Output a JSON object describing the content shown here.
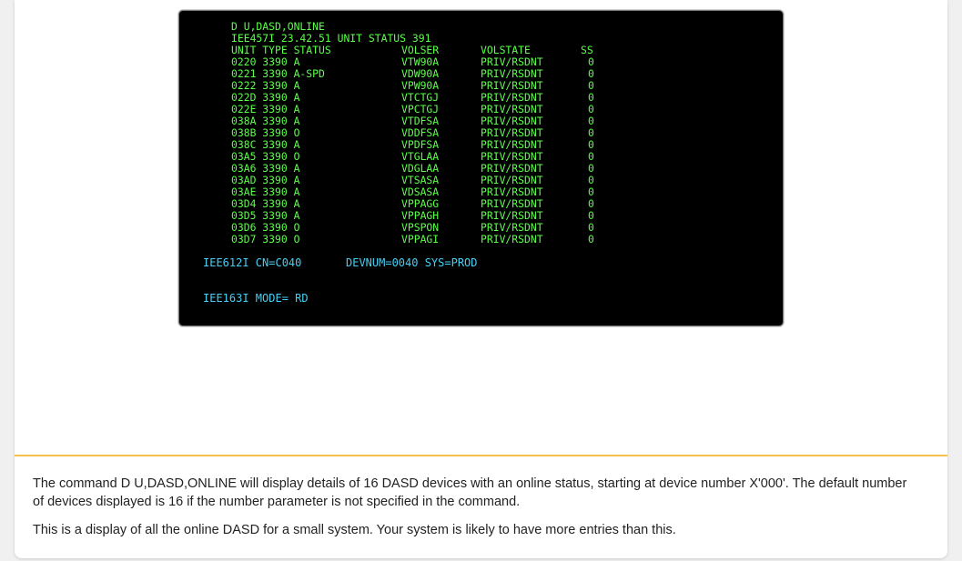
{
  "terminal": {
    "command": "D U,DASD,ONLINE",
    "response_header": "IEE457I 23.42.51 UNIT STATUS 391",
    "columns": {
      "unit_type_status": "UNIT TYPE STATUS",
      "volser": "VOLSER",
      "volstate": "VOLSTATE",
      "ss": "SS"
    },
    "rows": [
      {
        "unit": "0220 3390 A",
        "volser": "VTW90A",
        "volstate": "PRIV/RSDNT",
        "ss": "0"
      },
      {
        "unit": "0221 3390 A-SPD",
        "volser": "VDW90A",
        "volstate": "PRIV/RSDNT",
        "ss": "0"
      },
      {
        "unit": "0222 3390 A",
        "volser": "VPW90A",
        "volstate": "PRIV/RSDNT",
        "ss": "0"
      },
      {
        "unit": "022D 3390 A",
        "volser": "VTCTGJ",
        "volstate": "PRIV/RSDNT",
        "ss": "0"
      },
      {
        "unit": "022E 3390 A",
        "volser": "VPCTGJ",
        "volstate": "PRIV/RSDNT",
        "ss": "0"
      },
      {
        "unit": "038A 3390 A",
        "volser": "VTDFSA",
        "volstate": "PRIV/RSDNT",
        "ss": "0"
      },
      {
        "unit": "038B 3390 O",
        "volser": "VDDFSA",
        "volstate": "PRIV/RSDNT",
        "ss": "0"
      },
      {
        "unit": "038C 3390 A",
        "volser": "VPDFSA",
        "volstate": "PRIV/RSDNT",
        "ss": "0"
      },
      {
        "unit": "03A5 3390 O",
        "volser": "VTGLAA",
        "volstate": "PRIV/RSDNT",
        "ss": "0"
      },
      {
        "unit": "03A6 3390 A",
        "volser": "VDGLAA",
        "volstate": "PRIV/RSDNT",
        "ss": "0"
      },
      {
        "unit": "03AD 3390 A",
        "volser": "VTSASA",
        "volstate": "PRIV/RSDNT",
        "ss": "0"
      },
      {
        "unit": "03AE 3390 A",
        "volser": "VDSASA",
        "volstate": "PRIV/RSDNT",
        "ss": "0"
      },
      {
        "unit": "03D4 3390 A",
        "volser": "VPPAGG",
        "volstate": "PRIV/RSDNT",
        "ss": "0"
      },
      {
        "unit": "03D5 3390 A",
        "volser": "VPPAGH",
        "volstate": "PRIV/RSDNT",
        "ss": "0"
      },
      {
        "unit": "03D6 3390 O",
        "volser": "VPSPON",
        "volstate": "PRIV/RSDNT",
        "ss": "0"
      },
      {
        "unit": "03D7 3390 O",
        "volser": "VPPAGI",
        "volstate": "PRIV/RSDNT",
        "ss": "0"
      }
    ],
    "msg_cn": "IEE612I CN=C040",
    "msg_devnum": "DEVNUM=0040 SYS=PROD",
    "msg_mode": "IEE163I MODE= RD",
    "colors": {
      "green": "#5cff4a",
      "cyan": "#45d0f5"
    }
  },
  "caption": {
    "paragraph1": "The command D U,DASD,ONLINE will display details of 16 DASD devices with an online status, starting at device number X'000'. The default number of devices displayed is 16 if the number parameter is not specified in the command.",
    "paragraph2": "This is a display of all the online DASD for a small system. Your system is likely to have more entries than this."
  },
  "colors": {
    "accent_divider": "#f2c14e"
  }
}
